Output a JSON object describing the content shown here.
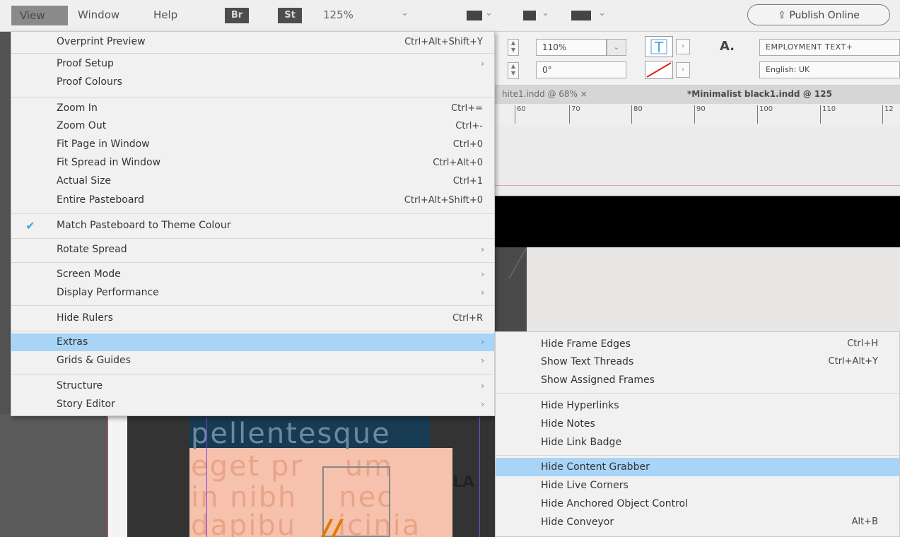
{
  "menubar": {
    "view": "View",
    "window": "Window",
    "help": "Help",
    "br": "Br",
    "st": "St",
    "zoom": "125%",
    "publish": "Publish Online"
  },
  "control_panel": {
    "scale": "110%",
    "angle": "0°",
    "style": "EMPLOYMENT TEXT+",
    "language": "English: UK"
  },
  "tabs": {
    "tab1": "hite1.indd @ 68%",
    "tab1_close": "×",
    "tab2": "*Minimalist black1.indd @ 125"
  },
  "ruler": [
    "60",
    "70",
    "80",
    "90",
    "100",
    "110",
    "12"
  ],
  "document_text": {
    "line1": "pellentesque",
    "line2": "eget pr    um",
    "line3": "in nibh    nec",
    "line4": "dapibu    icinia",
    "side_letters": "LA"
  },
  "view_menu": {
    "items": [
      {
        "label": "Overprint Preview",
        "shortcut": "Ctrl+Alt+Shift+Y"
      },
      {
        "label": "Proof Setup",
        "arrow": "›"
      },
      {
        "label": "Proof Colours"
      },
      {
        "label": "Zoom In",
        "shortcut": "Ctrl+="
      },
      {
        "label": "Zoom Out",
        "shortcut": "Ctrl+-"
      },
      {
        "label": "Fit Page in Window",
        "shortcut": "Ctrl+0"
      },
      {
        "label": "Fit Spread in Window",
        "shortcut": "Ctrl+Alt+0"
      },
      {
        "label": "Actual Size",
        "shortcut": "Ctrl+1"
      },
      {
        "label": "Entire Pasteboard",
        "shortcut": "Ctrl+Alt+Shift+0"
      },
      {
        "label": "Match Pasteboard to Theme Colour",
        "checked": "✔"
      },
      {
        "label": "Rotate Spread",
        "arrow": "›"
      },
      {
        "label": "Screen Mode",
        "arrow": "›"
      },
      {
        "label": "Display Performance",
        "arrow": "›"
      },
      {
        "label": "Hide Rulers",
        "shortcut": "Ctrl+R"
      },
      {
        "label": "Extras",
        "arrow": "›"
      },
      {
        "label": "Grids & Guides",
        "arrow": "›"
      },
      {
        "label": "Structure",
        "arrow": "›"
      },
      {
        "label": "Story Editor",
        "arrow": "›"
      }
    ]
  },
  "extras_menu": {
    "items": [
      {
        "label": "Hide Frame Edges",
        "shortcut": "Ctrl+H"
      },
      {
        "label": "Show Text Threads",
        "shortcut": "Ctrl+Alt+Y"
      },
      {
        "label": "Show Assigned Frames"
      },
      {
        "label": "Hide Hyperlinks"
      },
      {
        "label": "Hide Notes"
      },
      {
        "label": "Hide Link Badge"
      },
      {
        "label": "Hide Content Grabber"
      },
      {
        "label": "Hide Live Corners"
      },
      {
        "label": "Hide Anchored Object Control"
      },
      {
        "label": "Hide Conveyor",
        "shortcut": "Alt+B"
      }
    ]
  }
}
